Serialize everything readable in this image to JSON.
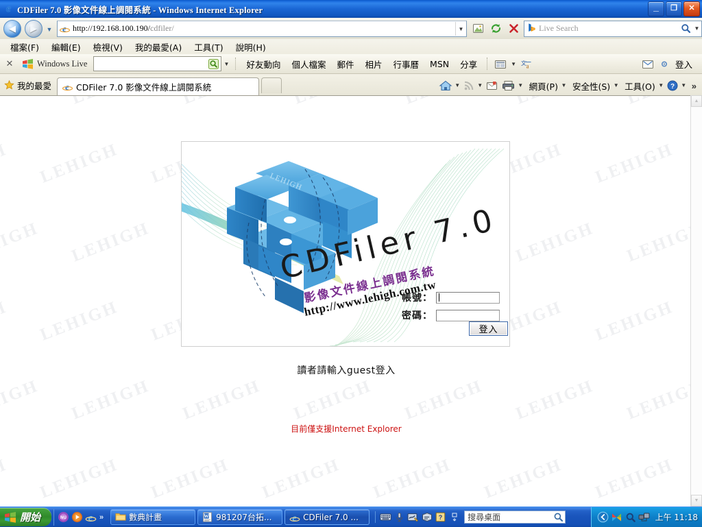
{
  "window": {
    "title": "CDFiler 7.0 影像文件線上調閱系統 - Windows Internet Explorer",
    "minimize_label": "_",
    "maximize_label": "❐",
    "close_label": "✕"
  },
  "navbar": {
    "back_label": "◀",
    "forward_label": "▶",
    "history_caret": "▼",
    "url_prefix": "http://192.168.100.190/",
    "url_suffix": "cdfiler/",
    "url_full": "http://192.168.100.190/cdfiler/",
    "address_caret": "▼",
    "search_logo": "b",
    "search_placeholder": "Live Search",
    "search_dropdown_caret": "▼"
  },
  "menu": {
    "items": [
      {
        "label": "檔案(F)"
      },
      {
        "label": "編輯(E)"
      },
      {
        "label": "檢視(V)"
      },
      {
        "label": "我的最愛(A)"
      },
      {
        "label": "工具(T)"
      },
      {
        "label": "說明(H)"
      }
    ]
  },
  "live_toolbar": {
    "close_label": "✕",
    "brand": "Windows Live",
    "search_value": "",
    "search_dropdown_caret": "▼",
    "links": [
      {
        "label": "好友動向"
      },
      {
        "label": "個人檔案"
      },
      {
        "label": "郵件"
      },
      {
        "label": "相片"
      },
      {
        "label": "行事曆"
      },
      {
        "label": "MSN"
      },
      {
        "label": "分享"
      }
    ],
    "right_dropdown_caret": "▼",
    "login_label": "登入"
  },
  "tabbar": {
    "favorites_label": "我的最愛",
    "tab_label": "CDFiler 7.0 影像文件線上調閱系統",
    "new_tab_label": ""
  },
  "commandbar": {
    "home_caret": "▼",
    "feeds_caret": "▼",
    "print_caret": "▼",
    "page_label": "網頁(P)",
    "page_caret": "▼",
    "safety_label": "安全性(S)",
    "safety_caret": "▼",
    "tools_label": "工具(O)",
    "tools_caret": "▼",
    "help_caret": "▼",
    "overflow_label": "»"
  },
  "page": {
    "watermark_text": "LEHIGH",
    "heading_en": "CDFiler",
    "heading_cn": "影像文件線上調閱系統",
    "logo": {
      "cube_label": "LEHIGH",
      "product_name": "CDFiler 7.0",
      "subtitle_cn": "影像文件線上調閱系統",
      "url": "http://www.lehigh.com.tw"
    },
    "form": {
      "account_label": "帳號：",
      "account_value": "",
      "password_label": "密碼：",
      "password_value": "",
      "submit_label": "登入"
    },
    "hint_text": "讀者請輸入guest登入",
    "warning_text": "目前僅支援Internet Explorer"
  },
  "scrollbar": {
    "up_label": "▲",
    "down_label": "▼"
  },
  "taskbar": {
    "start_label": "開始",
    "quicklaunch_overflow": "»",
    "tasks": [
      {
        "label": "數典計畫",
        "icon": "folder-icon",
        "active": false
      },
      {
        "label": "981207台拓...",
        "icon": "word-document-icon",
        "active": false
      },
      {
        "label": "CDFiler 7.0 ...",
        "icon": "ie-icon",
        "active": true
      }
    ],
    "desktop_search_placeholder": "搜尋桌面",
    "clock": "上午 11:18"
  },
  "colors": {
    "title_bar_blue": "#1d6fe0",
    "heading_red": "#d4162a",
    "heading_navy": "#232a6e",
    "warning_red": "#cc1111",
    "logo_blue": "#2f8fd4",
    "logo_purple": "#7a2f8f",
    "taskbar_blue": "#1a55bc",
    "start_green": "#2f8a2a"
  }
}
